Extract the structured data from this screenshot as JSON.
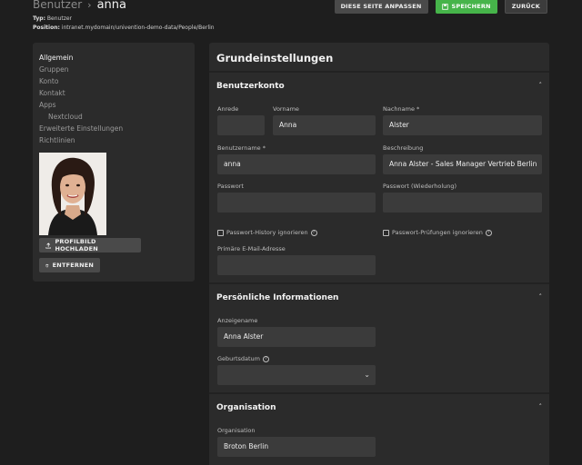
{
  "breadcrumb": {
    "parent": "Benutzer",
    "current": "anna"
  },
  "meta": {
    "typ_label": "Typ:",
    "typ_value": "Benutzer",
    "position_label": "Position:",
    "position_value": "intranet.mydomain/univention-demo-data/People/Berlin"
  },
  "actions": {
    "customize_label": "DIESE SEITE ANPASSEN",
    "save_label": "SPEICHERN",
    "back_label": "ZURÜCK"
  },
  "sidebar": {
    "items": [
      {
        "label": "Allgemein"
      },
      {
        "label": "Gruppen"
      },
      {
        "label": "Konto"
      },
      {
        "label": "Kontakt"
      },
      {
        "label": "Apps"
      },
      {
        "label": "Nextcloud"
      },
      {
        "label": "Erweiterte Einstellungen"
      },
      {
        "label": "Richtlinien"
      }
    ],
    "upload_label": "PROFILBILD HOCHLADEN",
    "remove_label": "ENTFERNEN"
  },
  "main": {
    "title": "Grundeinstellungen",
    "account": {
      "title": "Benutzerkonto",
      "anrede_label": "Anrede",
      "anrede_value": "",
      "vorname_label": "Vorname",
      "vorname_value": "Anna",
      "nachname_label": "Nachname *",
      "nachname_value": "Alster",
      "benutzername_label": "Benutzername *",
      "benutzername_value": "anna",
      "beschreibung_label": "Beschreibung",
      "beschreibung_value": "Anna Alster - Sales Manager Vertrieb Berlin",
      "passwort_label": "Passwort",
      "passwort_value": "",
      "passwort_wdh_label": "Passwort (Wiederholung)",
      "passwort_wdh_value": "",
      "history_label": "Passwort-History ignorieren",
      "checks_label": "Passwort-Prüfungen ignorieren",
      "email_label": "Primäre E-Mail-Adresse",
      "email_value": ""
    },
    "personal": {
      "title": "Persönliche Informationen",
      "anzeigename_label": "Anzeigename",
      "anzeigename_value": "Anna Alster",
      "geburtsdatum_label": "Geburtsdatum",
      "geburtsdatum_value": ""
    },
    "org": {
      "title": "Organisation",
      "organisation_label": "Organisation",
      "organisation_value": "Broton Berlin"
    }
  }
}
